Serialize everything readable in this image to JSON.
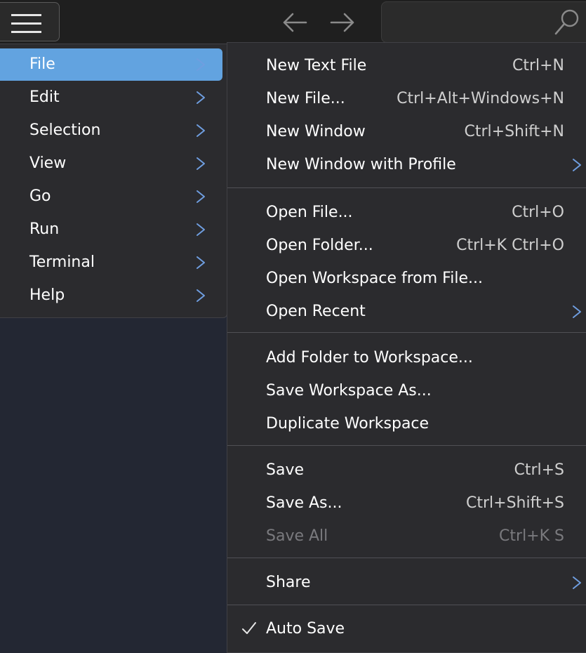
{
  "icons": {
    "menu": "hamburger-icon",
    "back": "arrow-left-icon",
    "forward": "arrow-right-icon",
    "search": "search-icon",
    "submenu": "chevron-right-icon",
    "checked": "checkmark-icon"
  },
  "colors": {
    "accent": "#62a3e0",
    "menu_bg": "#2b2b2e",
    "editor_bg": "#232733",
    "disabled_text": "#7a7a7e"
  },
  "menubar": {
    "items": [
      {
        "label": "File",
        "active": true
      },
      {
        "label": "Edit"
      },
      {
        "label": "Selection"
      },
      {
        "label": "View"
      },
      {
        "label": "Go"
      },
      {
        "label": "Run"
      },
      {
        "label": "Terminal"
      },
      {
        "label": "Help"
      }
    ]
  },
  "file_menu": {
    "groups": [
      [
        {
          "label": "New Text File",
          "shortcut": "Ctrl+N"
        },
        {
          "label": "New File...",
          "shortcut": "Ctrl+Alt+Windows+N"
        },
        {
          "label": "New Window",
          "shortcut": "Ctrl+Shift+N"
        },
        {
          "label": "New Window with Profile",
          "submenu": true
        }
      ],
      [
        {
          "label": "Open File...",
          "shortcut": "Ctrl+O"
        },
        {
          "label": "Open Folder...",
          "shortcut": "Ctrl+K Ctrl+O"
        },
        {
          "label": "Open Workspace from File..."
        },
        {
          "label": "Open Recent",
          "submenu": true
        }
      ],
      [
        {
          "label": "Add Folder to Workspace..."
        },
        {
          "label": "Save Workspace As..."
        },
        {
          "label": "Duplicate Workspace"
        }
      ],
      [
        {
          "label": "Save",
          "shortcut": "Ctrl+S"
        },
        {
          "label": "Save As...",
          "shortcut": "Ctrl+Shift+S"
        },
        {
          "label": "Save All",
          "shortcut": "Ctrl+K S",
          "disabled": true
        }
      ],
      [
        {
          "label": "Share",
          "submenu": true
        }
      ],
      [
        {
          "label": "Auto Save",
          "checked": true
        }
      ]
    ]
  }
}
